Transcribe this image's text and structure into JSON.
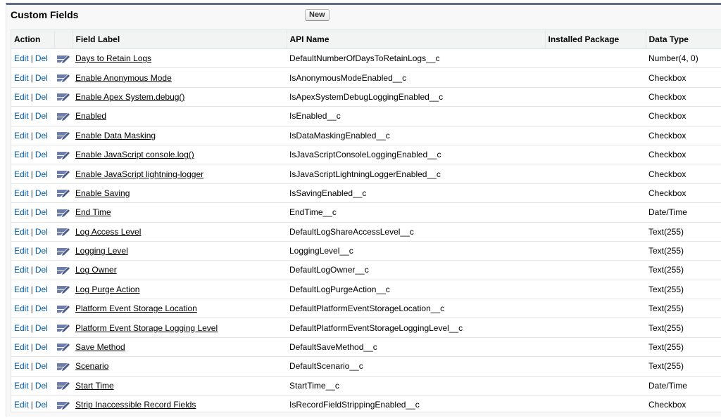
{
  "section": {
    "title": "Custom Fields",
    "new_label": "New"
  },
  "columns": {
    "action": "Action",
    "field_label": "Field Label",
    "api_name": "API Name",
    "installed_package": "Installed Package",
    "data_type": "Data Type"
  },
  "action_labels": {
    "edit": "Edit",
    "separator": "|",
    "del": "Del"
  },
  "row_icon": "custom-field-icon",
  "accent_color": "#5d6b86",
  "rows": [
    {
      "label": "Days to Retain Logs",
      "api": "DefaultNumberOfDaysToRetainLogs__c",
      "package": "",
      "type": "Number(4, 0)"
    },
    {
      "label": "Enable Anonymous Mode",
      "api": "IsAnonymousModeEnabled__c",
      "package": "",
      "type": "Checkbox"
    },
    {
      "label": "Enable Apex System.debug()",
      "api": "IsApexSystemDebugLoggingEnabled__c",
      "package": "",
      "type": "Checkbox"
    },
    {
      "label": "Enabled",
      "api": "IsEnabled__c",
      "package": "",
      "type": "Checkbox"
    },
    {
      "label": "Enable Data Masking",
      "api": "IsDataMaskingEnabled__c",
      "package": "",
      "type": "Checkbox"
    },
    {
      "label": "Enable JavaScript console.log()",
      "api": "IsJavaScriptConsoleLoggingEnabled__c",
      "package": "",
      "type": "Checkbox"
    },
    {
      "label": "Enable JavaScript lightning-logger",
      "api": "IsJavaScriptLightningLoggerEnabled__c",
      "package": "",
      "type": "Checkbox"
    },
    {
      "label": "Enable Saving",
      "api": "IsSavingEnabled__c",
      "package": "",
      "type": "Checkbox"
    },
    {
      "label": "End Time",
      "api": "EndTime__c",
      "package": "",
      "type": "Date/Time"
    },
    {
      "label": "Log Access Level",
      "api": "DefaultLogShareAccessLevel__c",
      "package": "",
      "type": "Text(255)"
    },
    {
      "label": "Logging Level",
      "api": "LoggingLevel__c",
      "package": "",
      "type": "Text(255)"
    },
    {
      "label": "Log Owner",
      "api": "DefaultLogOwner__c",
      "package": "",
      "type": "Text(255)"
    },
    {
      "label": "Log Purge Action",
      "api": "DefaultLogPurgeAction__c",
      "package": "",
      "type": "Text(255)"
    },
    {
      "label": "Platform Event Storage Location",
      "api": "DefaultPlatformEventStorageLocation__c",
      "package": "",
      "type": "Text(255)"
    },
    {
      "label": "Platform Event Storage Logging Level",
      "api": "DefaultPlatformEventStorageLoggingLevel__c",
      "package": "",
      "type": "Text(255)"
    },
    {
      "label": "Save Method",
      "api": "DefaultSaveMethod__c",
      "package": "",
      "type": "Text(255)"
    },
    {
      "label": "Scenario",
      "api": "DefaultScenario__c",
      "package": "",
      "type": "Text(255)"
    },
    {
      "label": "Start Time",
      "api": "StartTime__c",
      "package": "",
      "type": "Date/Time"
    },
    {
      "label": "Strip Inaccessible Record Fields",
      "api": "IsRecordFieldStrippingEnabled__c",
      "package": "",
      "type": "Checkbox"
    }
  ]
}
